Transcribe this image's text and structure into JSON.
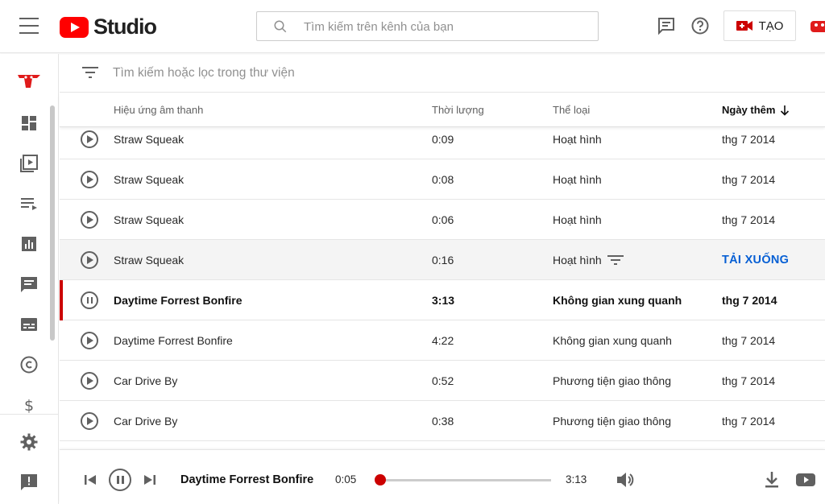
{
  "header": {
    "app_name": "Studio",
    "search_placeholder": "Tìm kiếm trên kênh của bạn",
    "create_label": "TẠO"
  },
  "filter": {
    "placeholder": "Tìm kiếm hoặc lọc trong thư viện"
  },
  "table": {
    "columns": [
      "Hiệu ứng âm thanh",
      "Thời lượng",
      "Thể loại",
      "Ngày thêm"
    ],
    "sort_column": "Ngày thêm",
    "rows": [
      {
        "title": "Straw Squeak",
        "duration": "0:09",
        "genre": "Hoạt hình",
        "date": "thg 7 2014"
      },
      {
        "title": "Straw Squeak",
        "duration": "0:08",
        "genre": "Hoạt hình",
        "date": "thg 7 2014"
      },
      {
        "title": "Straw Squeak",
        "duration": "0:06",
        "genre": "Hoạt hình",
        "date": "thg 7 2014"
      },
      {
        "title": "Straw Squeak",
        "duration": "0:16",
        "genre": "Hoạt hình",
        "date": "TẢI XUỐNG"
      },
      {
        "title": "Daytime Forrest Bonfire",
        "duration": "3:13",
        "genre": "Không gian xung quanh",
        "date": "thg 7 2014"
      },
      {
        "title": "Daytime Forrest Bonfire",
        "duration": "4:22",
        "genre": "Không gian xung quanh",
        "date": "thg 7 2014"
      },
      {
        "title": "Car Drive By",
        "duration": "0:52",
        "genre": "Phương tiện giao thông",
        "date": "thg 7 2014"
      },
      {
        "title": "Car Drive By",
        "duration": "0:38",
        "genre": "Phương tiện giao thông",
        "date": "thg 7 2014"
      }
    ]
  },
  "player": {
    "title": "Daytime Forrest Bonfire",
    "current_time": "0:05",
    "duration": "3:13",
    "progress": 0.026
  },
  "colors": {
    "brand": "#ff0000",
    "accent": "#cc0000",
    "link": "#065fd4"
  },
  "icons": {
    "nav": [
      "dashboard-icon",
      "videos-icon",
      "playlists-icon",
      "analytics-icon",
      "comments-icon",
      "subtitles-icon",
      "copyright-icon",
      "monetization-icon",
      "settings-icon",
      "feedback-icon"
    ]
  }
}
